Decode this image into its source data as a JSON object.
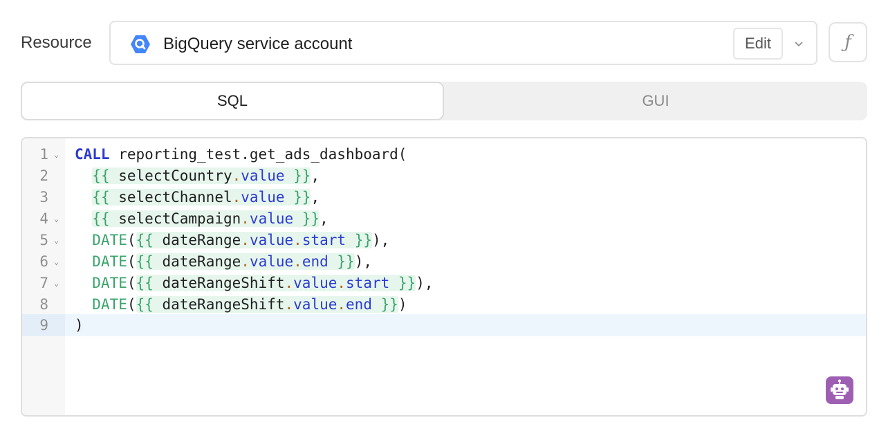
{
  "resource": {
    "label": "Resource",
    "name": "BigQuery service account",
    "edit_label": "Edit",
    "icon": "bigquery-icon",
    "fx_label": "ƒ"
  },
  "tabs": [
    {
      "label": "SQL",
      "active": true
    },
    {
      "label": "GUI",
      "active": false
    }
  ],
  "editor": {
    "active_line": 9,
    "lines": [
      {
        "n": "1",
        "fold": true
      },
      {
        "n": "2",
        "fold": false
      },
      {
        "n": "3",
        "fold": false
      },
      {
        "n": "4",
        "fold": true
      },
      {
        "n": "5",
        "fold": true
      },
      {
        "n": "6",
        "fold": true
      },
      {
        "n": "7",
        "fold": true
      },
      {
        "n": "8",
        "fold": false
      },
      {
        "n": "9",
        "fold": false
      }
    ],
    "tokens": {
      "l1_kw": "CALL",
      "l1_rest": " reporting_test.get_ads_dashboard(",
      "l2_var": "selectCountry",
      "l3_var": "selectChannel",
      "l4_var": "selectCampaign",
      "l5_var": "dateRange",
      "l6_var": "dateRange",
      "l7_var": "dateRangeShift",
      "l8_var": "dateRangeShift",
      "date_fn": "DATE",
      "value": "value",
      "start": "start",
      "end": "end",
      "open_tpl": "{{",
      "close_tpl": "}}",
      "l9": ")"
    }
  },
  "colors": {
    "keyword": "#2b3bd1",
    "template": "#3aa46b",
    "ai_button": "#9e5fb3"
  }
}
